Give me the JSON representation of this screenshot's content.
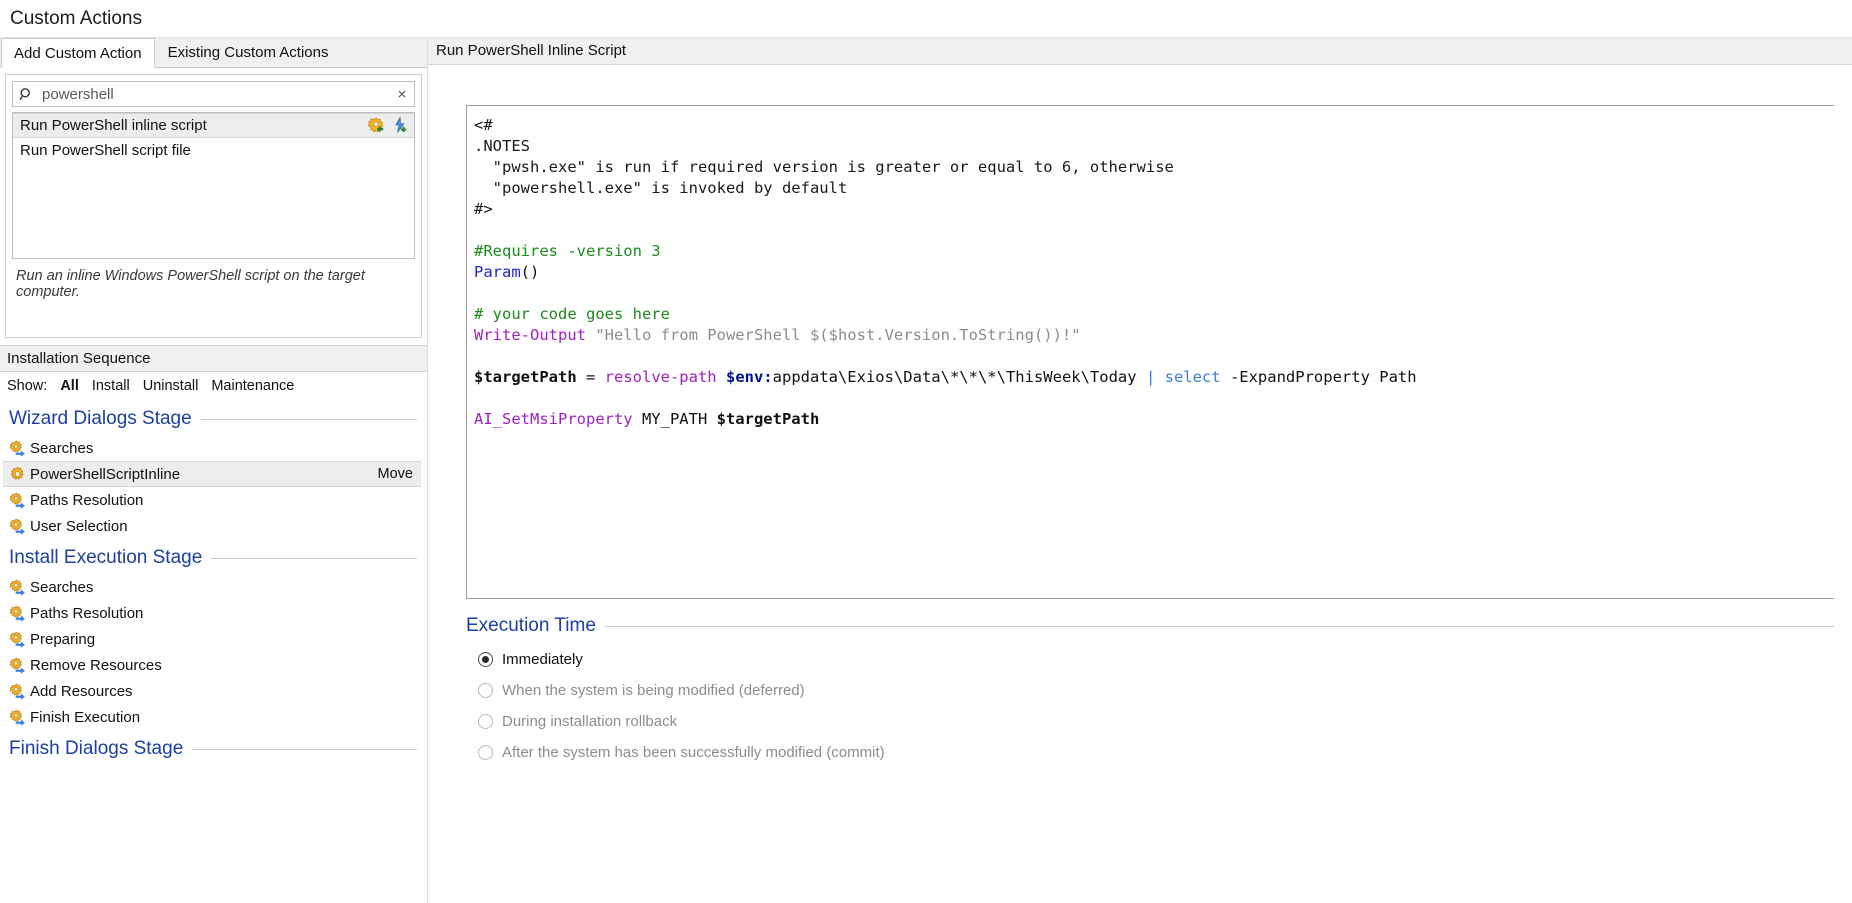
{
  "window": {
    "title": "Custom Actions"
  },
  "tabs": [
    {
      "label": "Add Custom Action",
      "active": true
    },
    {
      "label": "Existing Custom Actions",
      "active": false
    }
  ],
  "search": {
    "value": "powershell",
    "placeholder": "Search",
    "icon": "search-icon",
    "clear_icon": "×"
  },
  "results": {
    "items": [
      {
        "label": "Run PowerShell inline script",
        "selected": true
      },
      {
        "label": "Run PowerShell script file",
        "selected": false
      }
    ],
    "row_actions": [
      {
        "name": "add-custom-action-icon"
      },
      {
        "name": "add-custom-action-with-properties-icon"
      }
    ]
  },
  "hint": "Run an inline Windows PowerShell script on the target computer.",
  "sequence_panel": {
    "header": "Installation Sequence",
    "show_label": "Show:",
    "filters": [
      {
        "label": "All",
        "selected": true
      },
      {
        "label": "Install",
        "selected": false
      },
      {
        "label": "Uninstall",
        "selected": false
      },
      {
        "label": "Maintenance",
        "selected": false
      }
    ],
    "stages": [
      {
        "title": "Wizard Dialogs Stage",
        "items": [
          {
            "label": "Searches",
            "icon": "gear-arrow-icon",
            "selected": false,
            "action": ""
          },
          {
            "label": "PowerShellScriptInline",
            "icon": "gear-icon",
            "selected": true,
            "action": "Move"
          },
          {
            "label": "Paths Resolution",
            "icon": "gear-arrow-icon",
            "selected": false,
            "action": ""
          },
          {
            "label": "User Selection",
            "icon": "gear-arrow-icon",
            "selected": false,
            "action": ""
          }
        ]
      },
      {
        "title": "Install Execution Stage",
        "items": [
          {
            "label": "Searches",
            "icon": "gear-arrow-icon",
            "selected": false,
            "action": ""
          },
          {
            "label": "Paths Resolution",
            "icon": "gear-arrow-icon",
            "selected": false,
            "action": ""
          },
          {
            "label": "Preparing",
            "icon": "gear-arrow-icon",
            "selected": false,
            "action": ""
          },
          {
            "label": "Remove Resources",
            "icon": "gear-arrow-icon",
            "selected": false,
            "action": ""
          },
          {
            "label": "Add Resources",
            "icon": "gear-arrow-icon",
            "selected": false,
            "action": ""
          },
          {
            "label": "Finish Execution",
            "icon": "gear-arrow-icon",
            "selected": false,
            "action": ""
          }
        ]
      },
      {
        "title": "Finish Dialogs Stage",
        "items": []
      }
    ]
  },
  "detail": {
    "header": "Run PowerShell Inline Script",
    "script_lines": [
      [
        {
          "t": "<#",
          "c": "c-cmt"
        }
      ],
      [
        {
          "t": ".NOTES",
          "c": "c-cmt"
        }
      ],
      [
        {
          "t": "  \"pwsh.exe\" is run if required version is greater or equal to 6, otherwise",
          "c": "c-cmt"
        }
      ],
      [
        {
          "t": "  \"powershell.exe\" is invoked by default",
          "c": "c-cmt"
        }
      ],
      [
        {
          "t": "#>",
          "c": "c-cmt"
        }
      ],
      [
        {
          "t": "",
          "c": "c-cmt"
        }
      ],
      [
        {
          "t": "#Requires -version 3",
          "c": "c-grn"
        }
      ],
      [
        {
          "t": "Param",
          "c": "c-blu"
        },
        {
          "t": "()",
          "c": "c-blk"
        }
      ],
      [
        {
          "t": "",
          "c": "c-cmt"
        }
      ],
      [
        {
          "t": "# your code goes here",
          "c": "c-grn"
        }
      ],
      [
        {
          "t": "Write-Output",
          "c": "c-pur"
        },
        {
          "t": " \"Hello from PowerShell $($host.Version.ToString())!\"",
          "c": "c-str"
        }
      ],
      [
        {
          "t": "",
          "c": "c-cmt"
        }
      ],
      [
        {
          "t": "$targetPath",
          "c": "c-var"
        },
        {
          "t": " = ",
          "c": "c-blk"
        },
        {
          "t": "resolve-path",
          "c": "c-pur"
        },
        {
          "t": " ",
          "c": "c-blk"
        },
        {
          "t": "$env:",
          "c": "c-env"
        },
        {
          "t": "appdata\\Exios\\Data\\*\\*\\*\\ThisWeek\\Today",
          "c": "c-blk"
        },
        {
          "t": " | ",
          "c": "c-lblue"
        },
        {
          "t": "select",
          "c": "c-lblue"
        },
        {
          "t": " -ExpandProperty Path",
          "c": "c-blk"
        }
      ],
      [
        {
          "t": "",
          "c": "c-cmt"
        }
      ],
      [
        {
          "t": "AI_SetMsiProperty",
          "c": "c-pur"
        },
        {
          "t": " MY_PATH ",
          "c": "c-blk"
        },
        {
          "t": "$targetPath",
          "c": "c-var"
        }
      ]
    ],
    "execution_time": {
      "title": "Execution Time",
      "options": [
        {
          "label": "Immediately",
          "checked": true,
          "disabled": false
        },
        {
          "label": "When the system is being modified (deferred)",
          "checked": false,
          "disabled": true
        },
        {
          "label": "During installation rollback",
          "checked": false,
          "disabled": true
        },
        {
          "label": "After the system has been successfully modified (commit)",
          "checked": false,
          "disabled": true
        }
      ]
    }
  },
  "colors": {
    "accent_heading": "#1c3fa0",
    "selection": "#ededed",
    "panel": "#f0f0f0",
    "comment": "#1a1a1a",
    "keyword_green": "#1a8b1a",
    "keyword_blue": "#2222cc",
    "cmdlet_purple": "#a020c0",
    "string_gray": "#8c8c8c",
    "env_blue": "#00109c",
    "pipe_blue": "#3b7ddd"
  }
}
